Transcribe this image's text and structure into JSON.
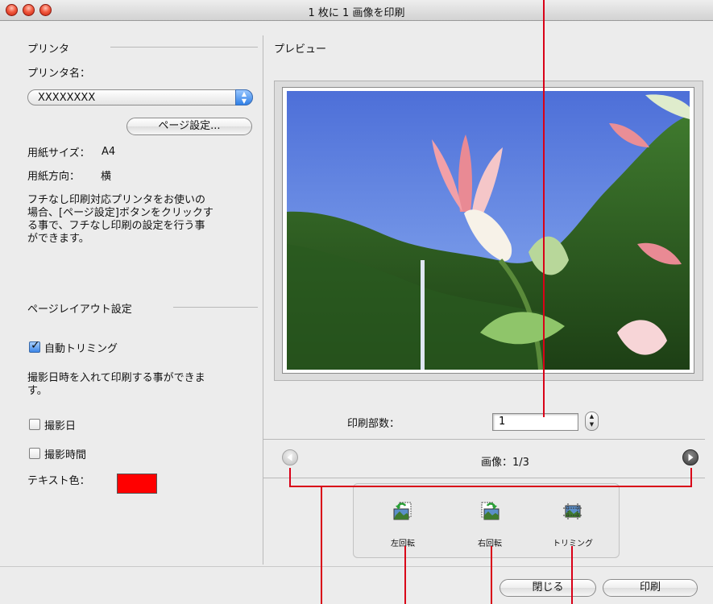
{
  "window": {
    "title": "1 枚に 1 画像を印刷"
  },
  "printer": {
    "section_label": "プリンタ",
    "name_label": "プリンタ名：",
    "selected": "XXXXXXXX",
    "page_setup_button": "ページ設定...",
    "paper_size_label": "用紙サイズ：",
    "paper_size_value": "A4",
    "orientation_label": "用紙方向：",
    "orientation_value": "横",
    "borderless_note": [
      "フチなし印刷対応プリンタをお使いの",
      "場合、[ページ設定]ボタンをクリックす",
      "る事で、フチなし印刷の設定を行う事",
      "ができます。"
    ]
  },
  "layout": {
    "section_label": "ページレイアウト設定",
    "auto_trim_label": "自動トリミング",
    "auto_trim_checked": true,
    "date_note": [
      "撮影日時を入れて印刷する事ができま",
      "す。"
    ],
    "shooting_date_label": "撮影日",
    "shooting_date_checked": false,
    "shooting_time_label": "撮影時間",
    "shooting_time_checked": false,
    "text_color_label": "テキスト色：",
    "text_color": "#ff0000"
  },
  "preview": {
    "label": "プレビュー",
    "copies_label": "印刷部数：",
    "copies_value": "1",
    "image_counter": "画像：1/3"
  },
  "tools": {
    "rotate_left": "左回転",
    "rotate_right": "右回転",
    "trimming": "トリミング"
  },
  "buttons": {
    "close": "閉じる",
    "print": "印刷"
  },
  "colors": {
    "callout": "#d90018",
    "sky": "#5c7fe0",
    "accent_blue": "#3c86e8"
  }
}
